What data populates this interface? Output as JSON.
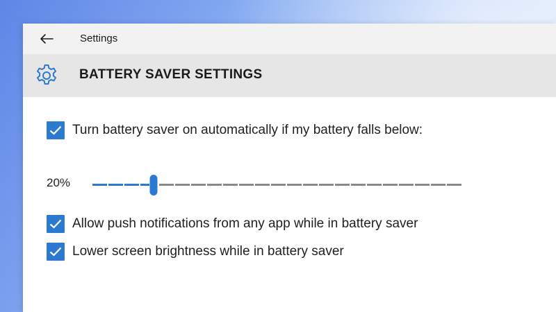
{
  "window": {
    "title": "Settings"
  },
  "header": {
    "title": "BATTERY SAVER SETTINGS",
    "icon": "gear-icon"
  },
  "auto_saver": {
    "checked": true,
    "label": "Turn battery saver on automatically if my battery falls below:"
  },
  "threshold": {
    "display": "20%",
    "percent": 20
  },
  "options": [
    {
      "checked": true,
      "label": "Allow push notifications from any app while in battery saver"
    },
    {
      "checked": true,
      "label": "Lower screen brightness while in battery saver"
    }
  ],
  "colors": {
    "accent": "#2b79d0",
    "header_bg": "#e6e6e6",
    "titlebar_bg": "#f2f2f2"
  }
}
